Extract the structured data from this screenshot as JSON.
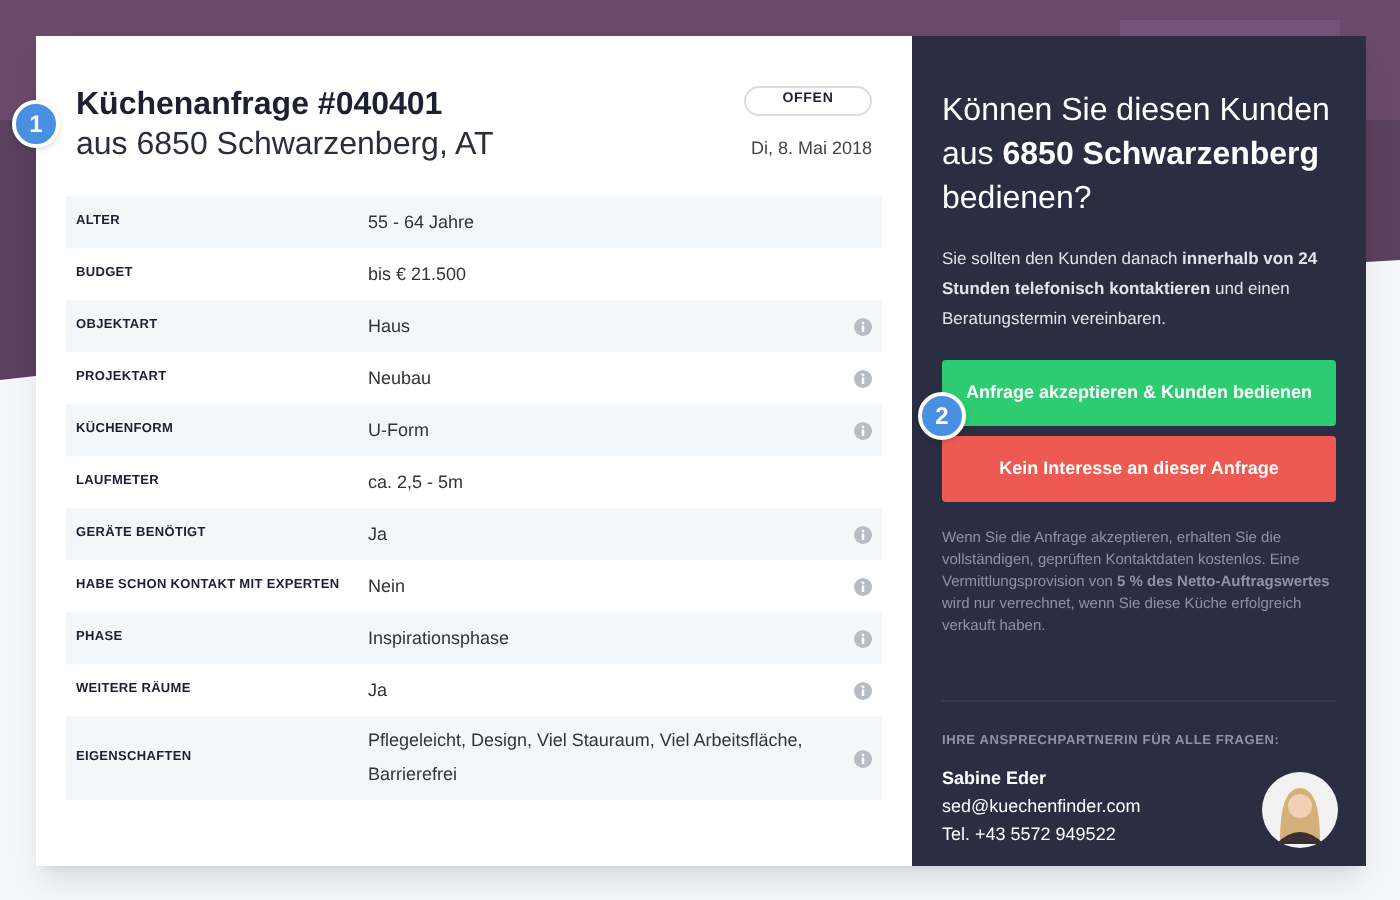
{
  "request": {
    "title": "Küchenanfrage #040401",
    "subtitle": "aus 6850 Schwarzenberg, AT",
    "status": "OFFEN",
    "date": "Di, 8. Mai 2018",
    "marker": "1"
  },
  "details": [
    {
      "label": "ALTER",
      "value": "55 - 64 Jahre",
      "info": false
    },
    {
      "label": "BUDGET",
      "value": "bis € 21.500",
      "info": false
    },
    {
      "label": "OBJEKTART",
      "value": "Haus",
      "info": true
    },
    {
      "label": "PROJEKTART",
      "value": "Neubau",
      "info": true
    },
    {
      "label": "KÜCHENFORM",
      "value": "U-Form",
      "info": true
    },
    {
      "label": "LAUFMETER",
      "value": "ca. 2,5 - 5m",
      "info": false
    },
    {
      "label": "GERÄTE BENÖTIGT",
      "value": "Ja",
      "info": true
    },
    {
      "label": "HABE SCHON KONTAKT MIT EXPERTEN",
      "value": "Nein",
      "info": true
    },
    {
      "label": "PHASE",
      "value": "Inspirationsphase",
      "info": true
    },
    {
      "label": "WEITERE RÄUME",
      "value": "Ja",
      "info": true
    },
    {
      "label": "EIGENSCHAFTEN",
      "value": "Pflegeleicht, Design, Viel Stauraum, Viel Arbeitsfläche, Barrierefrei",
      "info": true
    }
  ],
  "offer": {
    "question": "Können Sie diesen Kunden aus **6850 Schwarzenberg** bedienen?",
    "instruction": "Sie sollten den Kunden danach **innerhalb von 24 Stunden telefonisch kontaktieren** und einen Beratungstermin vereinbaren.",
    "buttons": [
      {
        "label": "Anfrage akzeptieren & Kunden bedienen",
        "kind": "accept"
      },
      {
        "label": "Kein Interesse an dieser Anfrage",
        "kind": "decline"
      }
    ],
    "marker": "2",
    "note": "Wenn Sie die Anfrage akzeptieren, erhalten Sie die vollständigen, geprüften Kontaktdaten kostenlos. Eine Vermittlungsprovision von **5 % des Netto-Auftragswertes** wird nur verrechnet, wenn Sie diese Küche erfolgreich verkauft haben."
  },
  "contact": {
    "heading": "IHRE ANSPRECHPARTNERIN FÜR ALLE FRAGEN:",
    "name": "Sabine Eder",
    "email": "sed@kuechenfinder.com",
    "phone": "Tel. +43 5572 949522"
  }
}
